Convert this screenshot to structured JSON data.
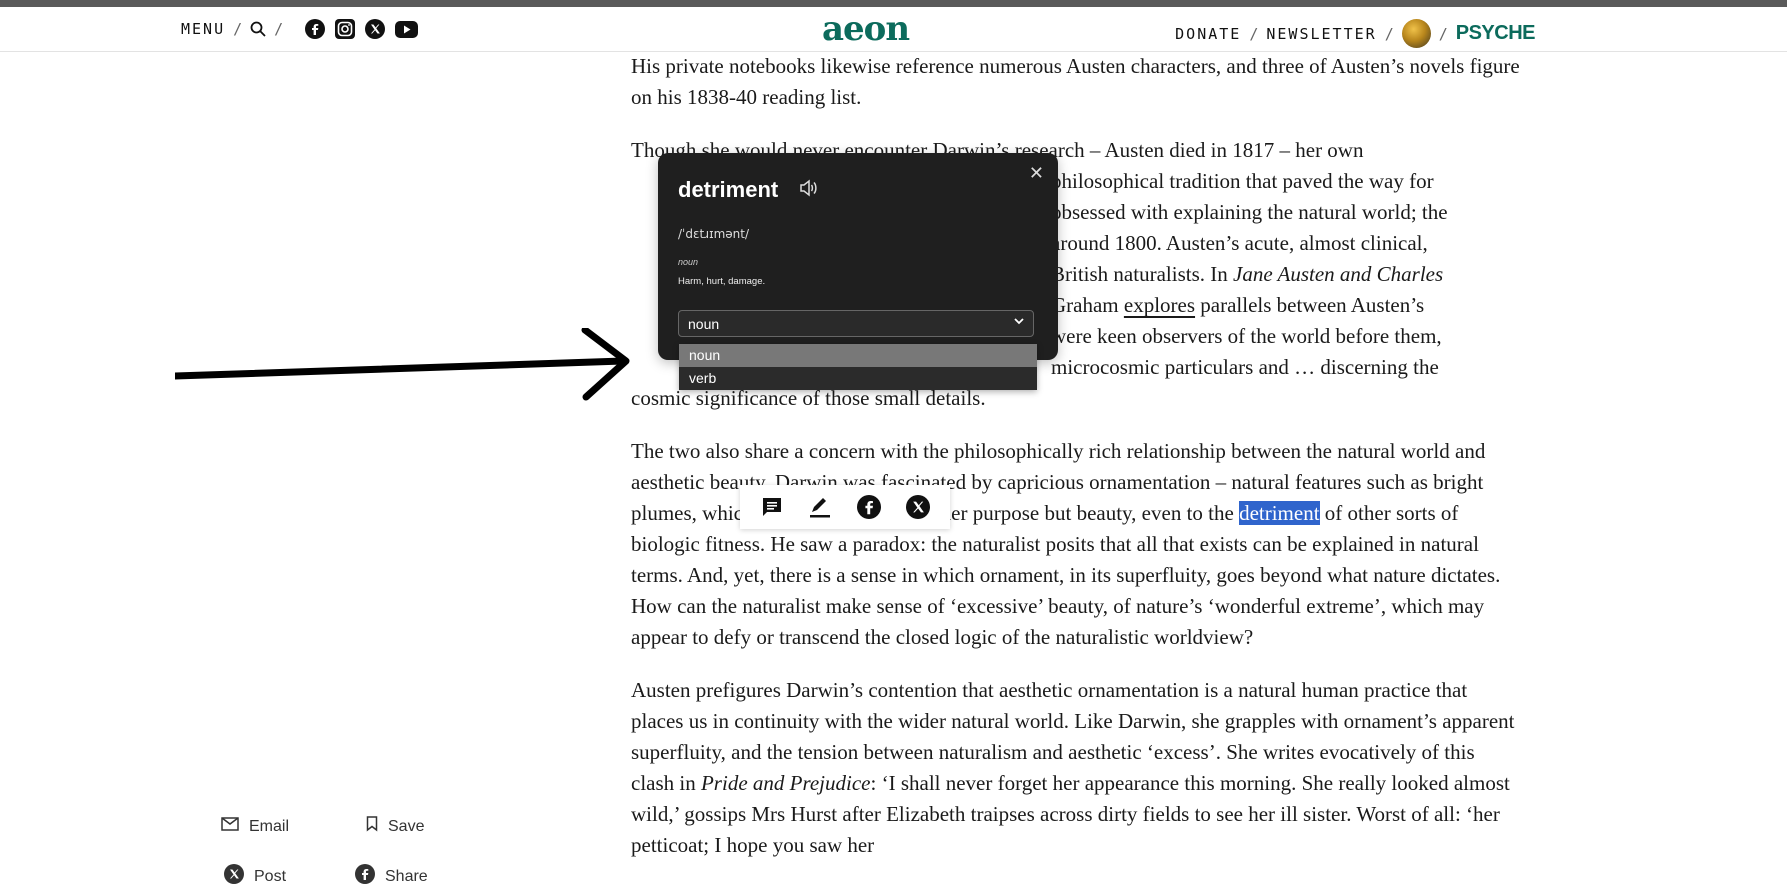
{
  "header": {
    "menu_label": "MENU",
    "slash": "/",
    "logo": "aeon",
    "donate_label": "DONATE",
    "newsletter_label": "NEWSLETTER",
    "psyche_label": "PSYCHE",
    "brand_color": "#0c6b5c"
  },
  "article": {
    "para1": "His private notebooks likewise reference numerous Austen characters, and three of Austen’s novels figure on his 1838-40 reading list.",
    "para2_lines": [
      "Though she would never encounter Darwin’s research – Austen died in 1817 – her own",
      "philosophical tradition that paved the way for",
      "obsessed with explaining the natural world; the",
      "around 1800. Austen’s acute, almost clinical,",
      "British naturalists. In",
      "Jane Austen and Charles",
      "Graham",
      "explores",
      "parallels between Austen’s",
      "were keen observers of the world before them,",
      "microcosmic particulars and … discerning the",
      "cosmic significance of those small details."
    ],
    "para3_a": "The two also share a concern with the philosophically rich relationship between the natural world and aesthetic beauty. Darwin was fascinated by capricious ornamentation – natural features such as bright plumes, which seemed to serve no other purpose but beauty, even to the",
    "para3_highlight": "detriment",
    "para3_b": "of other sorts of biologic fitness. He saw a paradox: the naturalist posits that all that exists can be explained in natural terms. And, yet, there is a sense in which ornament, in its superfluity, goes beyond what nature dictates. How can the naturalist make sense of ‘excessive’ beauty, of nature’s ‘wonderful extreme’, which may appear to defy or transcend the closed logic of the naturalistic worldview?",
    "para4_a": "Austen prefigures Darwin’s contention that aesthetic ornamentation is a natural human practice that places us in continuity with the wider natural world. Like Darwin, she grapples with ornament’s apparent superfluity, and the tension between naturalism and aesthetic ‘excess’. She writes evocatively of this clash in",
    "para4_italic": "Pride and Prejudice",
    "para4_b": ": ‘I shall never forget her appearance this morning. She really looked almost wild,’ gossips Mrs Hurst after Elizabeth traipses across dirty fields to see her ill sister. Worst of all: ‘her petticoat; I hope you saw her"
  },
  "dictionary": {
    "word": "detriment",
    "pronunciation": "/ˈdɛtɹɪmənt/",
    "part_of_speech": "noun",
    "definition": "Harm, hurt, damage.",
    "select_value": "noun",
    "options": [
      "noun",
      "verb"
    ],
    "close_glyph": "✕"
  },
  "share": {
    "email_label": "Email",
    "save_label": "Save",
    "post_label": "Post",
    "share_label": "Share"
  }
}
